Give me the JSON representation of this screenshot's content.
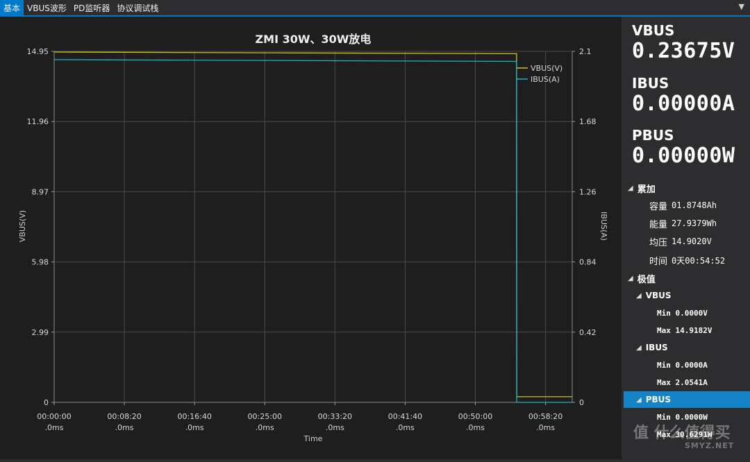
{
  "tabs": [
    {
      "label": "基本",
      "active": true
    },
    {
      "label": "VBUS波形",
      "active": false
    },
    {
      "label": "PD监听器",
      "active": false
    },
    {
      "label": "协议调试栈",
      "active": false
    }
  ],
  "tab_menu_icon": "chevron-down-icon",
  "chart_data": {
    "type": "line",
    "title": "ZMI 30W、30W放电",
    "xlabel": "Time",
    "ylabel": "VBUS(V)",
    "y2label": "IBUS(A)",
    "x_ticks": [
      [
        "00:00:00",
        ".0ms"
      ],
      [
        "00:08:20",
        ".0ms"
      ],
      [
        "00:16:40",
        ".0ms"
      ],
      [
        "00:25:00",
        ".0ms"
      ],
      [
        "00:33:20",
        ".0ms"
      ],
      [
        "00:41:40",
        ".0ms"
      ],
      [
        "00:50:00",
        ".0ms"
      ],
      [
        "00:58:20",
        ".0ms"
      ]
    ],
    "x_tick_seconds": [
      0,
      500,
      1000,
      1500,
      2000,
      2500,
      3000,
      3500
    ],
    "xlim_seconds": [
      0,
      3690
    ],
    "y_ticks": [
      "14.95",
      "11.96",
      "8.97",
      "5.98",
      "2.99",
      "0"
    ],
    "ylim": [
      0,
      14.95
    ],
    "y2_ticks": [
      "2.1",
      "1.68",
      "1.26",
      "0.84",
      "0.42",
      "0"
    ],
    "y2lim": [
      0,
      2.1
    ],
    "grid": true,
    "legend_position": "top-right",
    "series": [
      {
        "name": "VBUS(V)",
        "axis": "left",
        "color": "#d4c41c",
        "x_seconds": [
          0,
          3294,
          3295,
          3690
        ],
        "values": [
          14.92,
          14.85,
          0.24,
          0.24
        ]
      },
      {
        "name": "IBUS(A)",
        "axis": "right",
        "color": "#19b6c4",
        "x_seconds": [
          0,
          3294,
          3295,
          3690
        ],
        "values": [
          2.05,
          2.04,
          0,
          0
        ]
      }
    ]
  },
  "readouts": [
    {
      "label": "VBUS",
      "value": "0.23675V"
    },
    {
      "label": "IBUS",
      "value": "0.00000A"
    },
    {
      "label": "PBUS",
      "value": "0.00000W"
    }
  ],
  "accum": {
    "title": "累加",
    "items": [
      {
        "key": "容量",
        "value": "01.8748Ah"
      },
      {
        "key": "能量",
        "value": "27.9379Wh"
      },
      {
        "key": "均压",
        "value": "14.9020V"
      },
      {
        "key": "时间",
        "value": "0天00:54:52"
      }
    ]
  },
  "extremes": {
    "title": "极值",
    "groups": [
      {
        "name": "VBUS",
        "min": "Min 0.0000V",
        "max": "Max 14.9182V"
      },
      {
        "name": "IBUS",
        "min": "Min 0.0000A",
        "max": "Max 2.0541A"
      },
      {
        "name": "PBUS",
        "min": "Min 0.0000W",
        "max": "Max 30.6291W"
      }
    ]
  },
  "watermark": "值 什么值得买",
  "watermark_sub": "SMYZ.NET"
}
